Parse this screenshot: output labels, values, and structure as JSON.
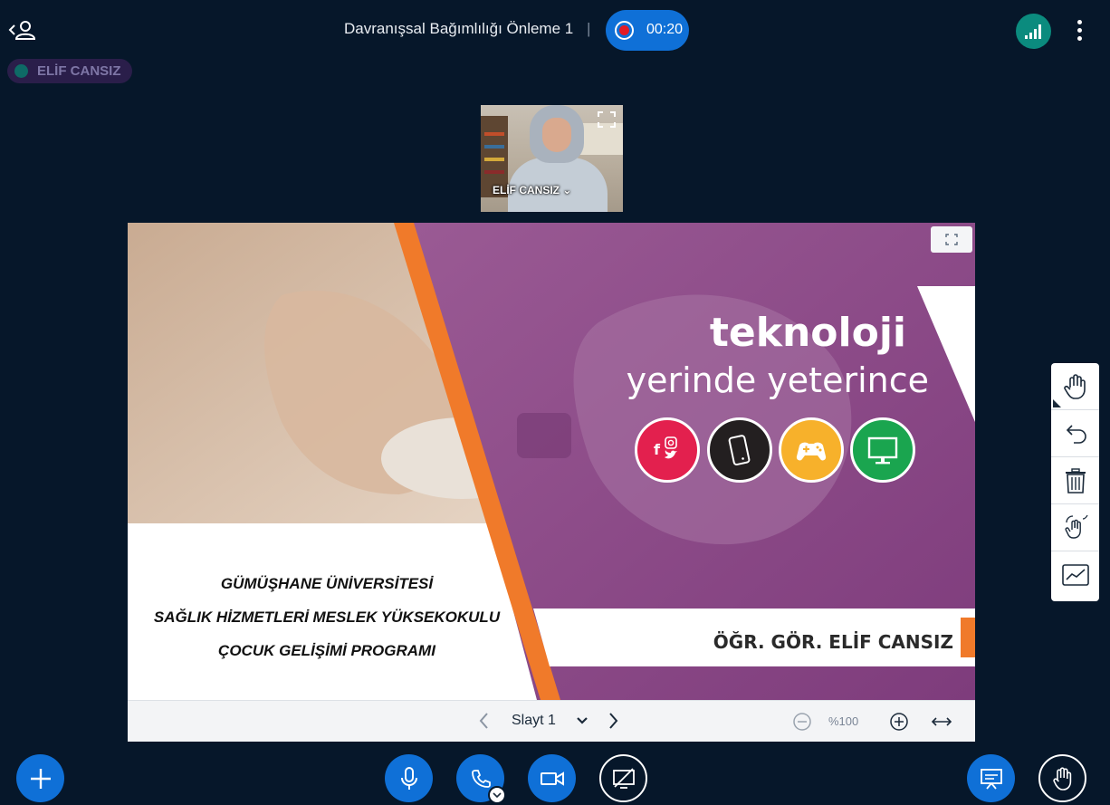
{
  "header": {
    "meeting_title": "Davranışsal Bağımlılığı Önleme 1",
    "separator": "|",
    "recording_time": "00:20",
    "recording_color": "#e21b26",
    "accent_color": "#0f70d7",
    "connection_color": "#0b8b7e"
  },
  "talking_indicator": {
    "name": "ELİF CANSIZ"
  },
  "webcam": {
    "name": "ELİF CANSIZ ⌄"
  },
  "slide": {
    "headline": "teknoloji",
    "subheadline": "yerinde yeterince",
    "institution_lines": [
      "GÜMÜŞHANE ÜNİVERSİTESİ",
      "SAĞLIK HİZMETLERİ MESLEK YÜKSEKOKULU",
      "ÇOCUK GELİŞİMİ PROGRAMI"
    ],
    "presenter": "ÖĞR. GÖR. ELİF CANSIZ",
    "icons": [
      "social-media-icon",
      "smartphone-icon",
      "gamepad-icon",
      "monitor-icon"
    ],
    "colors": {
      "purple": "#8e4a88",
      "orange": "#f07a2a",
      "social": "#e3204e",
      "phone": "#231f20",
      "game": "#f7b12b",
      "monitor": "#1aa54f"
    }
  },
  "presentation_toolbar": {
    "slide_label": "Slayt 1",
    "zoom_value": "%100"
  },
  "whiteboard_tools": [
    "pan-hand-icon",
    "undo-icon",
    "trash-icon",
    "multi-user-hand-icon",
    "chart-icon"
  ]
}
